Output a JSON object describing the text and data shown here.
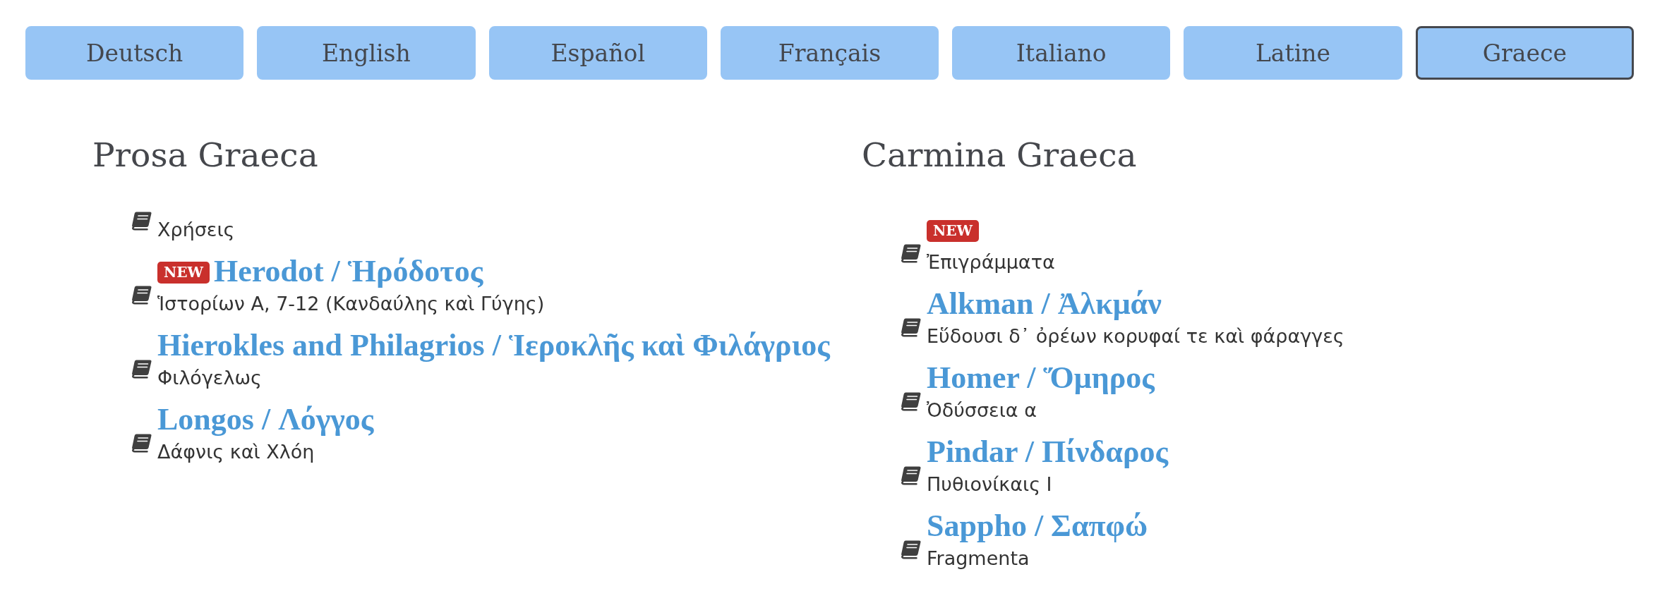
{
  "tabs": [
    {
      "label": "Deutsch",
      "selected": false
    },
    {
      "label": "English",
      "selected": false
    },
    {
      "label": "Español",
      "selected": false
    },
    {
      "label": "Français",
      "selected": false
    },
    {
      "label": "Italiano",
      "selected": false
    },
    {
      "label": "Latine",
      "selected": false
    },
    {
      "label": "Graece",
      "selected": true
    }
  ],
  "sections": [
    {
      "title": "Prosa Graeca",
      "items": [
        {
          "work": "Χρήσεις"
        },
        {
          "badge": "NEW",
          "author": "Herodot / Ἡρόδοτος",
          "work": "Ἱστορίων A, 7-12 (Κανδαύλης καὶ Γύγης)"
        },
        {
          "author": "Hierokles and Philagrios / Ἱεροκλῆς καὶ Φιλάγριος",
          "work": "Φιλόγελως"
        },
        {
          "author": "Longos / Λόγγος",
          "work": "Δάφνις καὶ Χλόη"
        }
      ]
    },
    {
      "title": "Carmina Graeca",
      "items": [
        {
          "badge": "NEW",
          "work": "Ἐπιγράμματα"
        },
        {
          "author": "Alkman / Ἀλκμάν",
          "work": "Εὕδουσι δ᾽ ὀρέων κορυφαί τε καὶ φάραγγες"
        },
        {
          "author": "Homer / Ὅμηρος",
          "work": "Ὀδύσσεια α"
        },
        {
          "author": "Pindar / Πίνδαρος",
          "work": "Πυθιονίκαις I"
        },
        {
          "author": "Sappho / Σαπφώ",
          "work": "Fragmenta"
        }
      ]
    }
  ]
}
